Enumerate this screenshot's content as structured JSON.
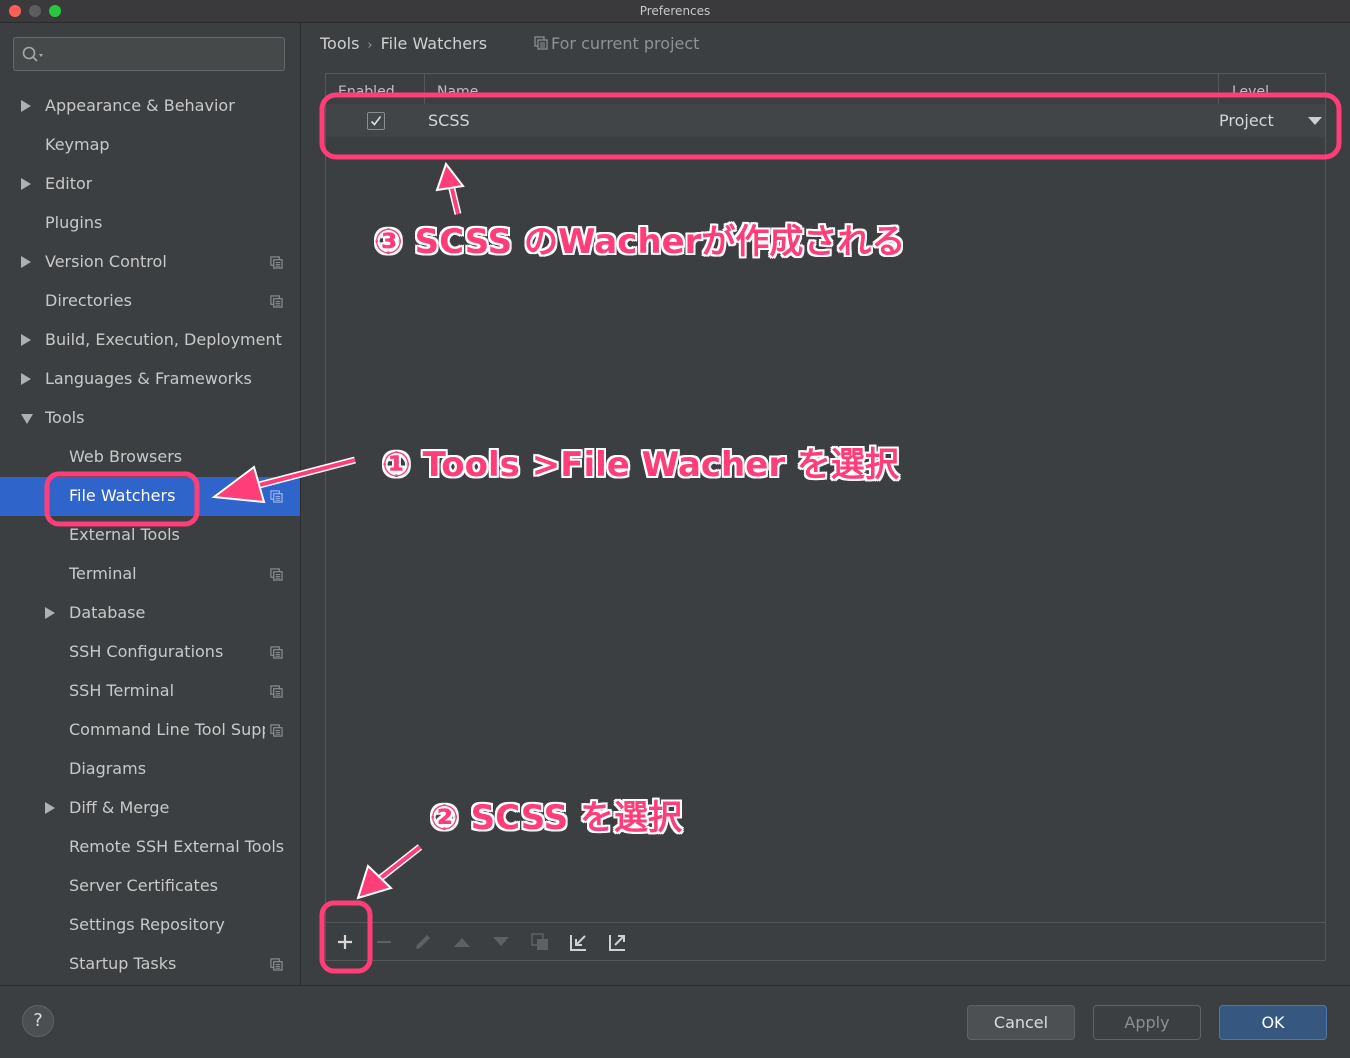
{
  "window": {
    "title": "Preferences"
  },
  "sidebar": {
    "items": [
      {
        "label": "Appearance & Behavior",
        "arrow": "right",
        "indent": 0,
        "project_icon": false
      },
      {
        "label": "Keymap",
        "arrow": "",
        "indent": 0,
        "project_icon": false
      },
      {
        "label": "Editor",
        "arrow": "right",
        "indent": 0,
        "project_icon": false
      },
      {
        "label": "Plugins",
        "arrow": "",
        "indent": 0,
        "project_icon": false
      },
      {
        "label": "Version Control",
        "arrow": "right",
        "indent": 0,
        "project_icon": true
      },
      {
        "label": "Directories",
        "arrow": "",
        "indent": 0,
        "project_icon": true
      },
      {
        "label": "Build, Execution, Deployment",
        "arrow": "right",
        "indent": 0,
        "project_icon": false
      },
      {
        "label": "Languages & Frameworks",
        "arrow": "right",
        "indent": 0,
        "project_icon": false
      },
      {
        "label": "Tools",
        "arrow": "down",
        "indent": 0,
        "project_icon": false
      },
      {
        "label": "Web Browsers",
        "arrow": "",
        "indent": 1,
        "project_icon": false
      },
      {
        "label": "File Watchers",
        "arrow": "",
        "indent": 1,
        "project_icon": true,
        "selected": true
      },
      {
        "label": "External Tools",
        "arrow": "",
        "indent": 1,
        "project_icon": false
      },
      {
        "label": "Terminal",
        "arrow": "",
        "indent": 1,
        "project_icon": true
      },
      {
        "label": "Database",
        "arrow": "right",
        "indent": 1,
        "project_icon": false
      },
      {
        "label": "SSH Configurations",
        "arrow": "",
        "indent": 1,
        "project_icon": true
      },
      {
        "label": "SSH Terminal",
        "arrow": "",
        "indent": 1,
        "project_icon": true
      },
      {
        "label": "Command Line Tool Support",
        "arrow": "",
        "indent": 1,
        "project_icon": true
      },
      {
        "label": "Diagrams",
        "arrow": "",
        "indent": 1,
        "project_icon": false
      },
      {
        "label": "Diff & Merge",
        "arrow": "right",
        "indent": 1,
        "project_icon": false
      },
      {
        "label": "Remote SSH External Tools",
        "arrow": "",
        "indent": 1,
        "project_icon": false
      },
      {
        "label": "Server Certificates",
        "arrow": "",
        "indent": 1,
        "project_icon": false
      },
      {
        "label": "Settings Repository",
        "arrow": "",
        "indent": 1,
        "project_icon": false
      },
      {
        "label": "Startup Tasks",
        "arrow": "",
        "indent": 1,
        "project_icon": true
      }
    ]
  },
  "breadcrumb": {
    "parent": "Tools",
    "separator": "›",
    "current": "File Watchers"
  },
  "scope_label": "For current project",
  "table": {
    "headers": {
      "enabled": "Enabled",
      "name": "Name",
      "level": "Level"
    },
    "rows": [
      {
        "enabled": true,
        "name": "SCSS",
        "level": "Project"
      }
    ]
  },
  "toolbar": {
    "icons": [
      "plus-icon",
      "minus-icon",
      "pencil-icon",
      "move-up-icon",
      "move-down-icon",
      "copy-icon",
      "import-icon",
      "export-icon"
    ]
  },
  "footer": {
    "help": "?",
    "cancel": "Cancel",
    "apply": "Apply",
    "ok": "OK"
  },
  "annotations": {
    "step1": "① Tools >File Wacher を選択",
    "step2": "② SCSS を選択",
    "step3": "③ SCSS のWacherが作成される",
    "color": "#ff3e79"
  },
  "colors": {
    "selection": "#2f65ca",
    "ok_button": "#365880",
    "background": "#3c3f41"
  }
}
